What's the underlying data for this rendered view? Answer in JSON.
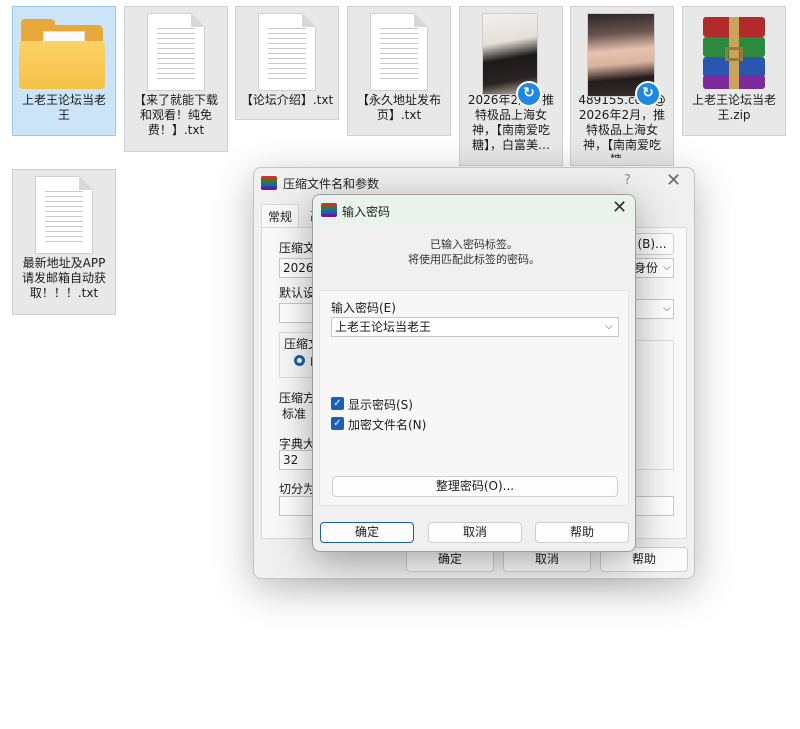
{
  "desktop": {
    "files": [
      {
        "name": "上老王论坛当老王",
        "type": "folder",
        "selected": true
      },
      {
        "name": "【来了就能下载和观看！纯免费！】.txt",
        "type": "text"
      },
      {
        "name": "【论坛介绍】.txt",
        "type": "text"
      },
      {
        "name": "【永久地址发布页】.txt",
        "type": "text"
      },
      {
        "name": "2026年2月，推特极品上海女神，【南南爱吃糖】，白富美…",
        "type": "video"
      },
      {
        "name": "489155.com@2026年2月，推特极品上海女神，【南南爱吃糖…",
        "type": "video"
      },
      {
        "name": "上老王论坛当老王.zip",
        "type": "archive"
      },
      {
        "name": "最新地址及APP请发邮箱自动获取！！！.txt",
        "type": "text"
      }
    ]
  },
  "main_window": {
    "title": "压缩文件名和参数",
    "help_glyph": "?",
    "close_glyph": "✕",
    "tabs": [
      "常规",
      "高"
    ],
    "labels": {
      "archive_name": "压缩文件",
      "default_settings": "默认设置",
      "archive_format": "压缩文",
      "compression_method": "压缩方式",
      "dictionary_size": "字典大小",
      "split_volumes": "切分为分"
    },
    "archive_name_value": "2026年",
    "browse_button": "(B)...",
    "profile_value": "身份",
    "radio_fragment": "R",
    "compression_method_value": "标准",
    "dictionary_size_value": "32",
    "ok": "确定",
    "cancel": "取消",
    "help": "帮助"
  },
  "password_dialog": {
    "title": "输入密码",
    "close_glyph": "✕",
    "message_line1": "已输入密码标签。",
    "message_line2": "将使用匹配此标签的密码。",
    "password_label": "输入密码(E)",
    "password_value": "上老王论坛当老王",
    "show_password": "显示密码(S)",
    "encrypt_filenames": "加密文件名(N)",
    "show_password_checked": true,
    "encrypt_filenames_checked": true,
    "organize_button": "整理密码(O)...",
    "ok": "确定",
    "cancel": "取消",
    "help": "帮助",
    "checkmark_glyph": "✓",
    "dropdown_glyph": "⌵"
  }
}
